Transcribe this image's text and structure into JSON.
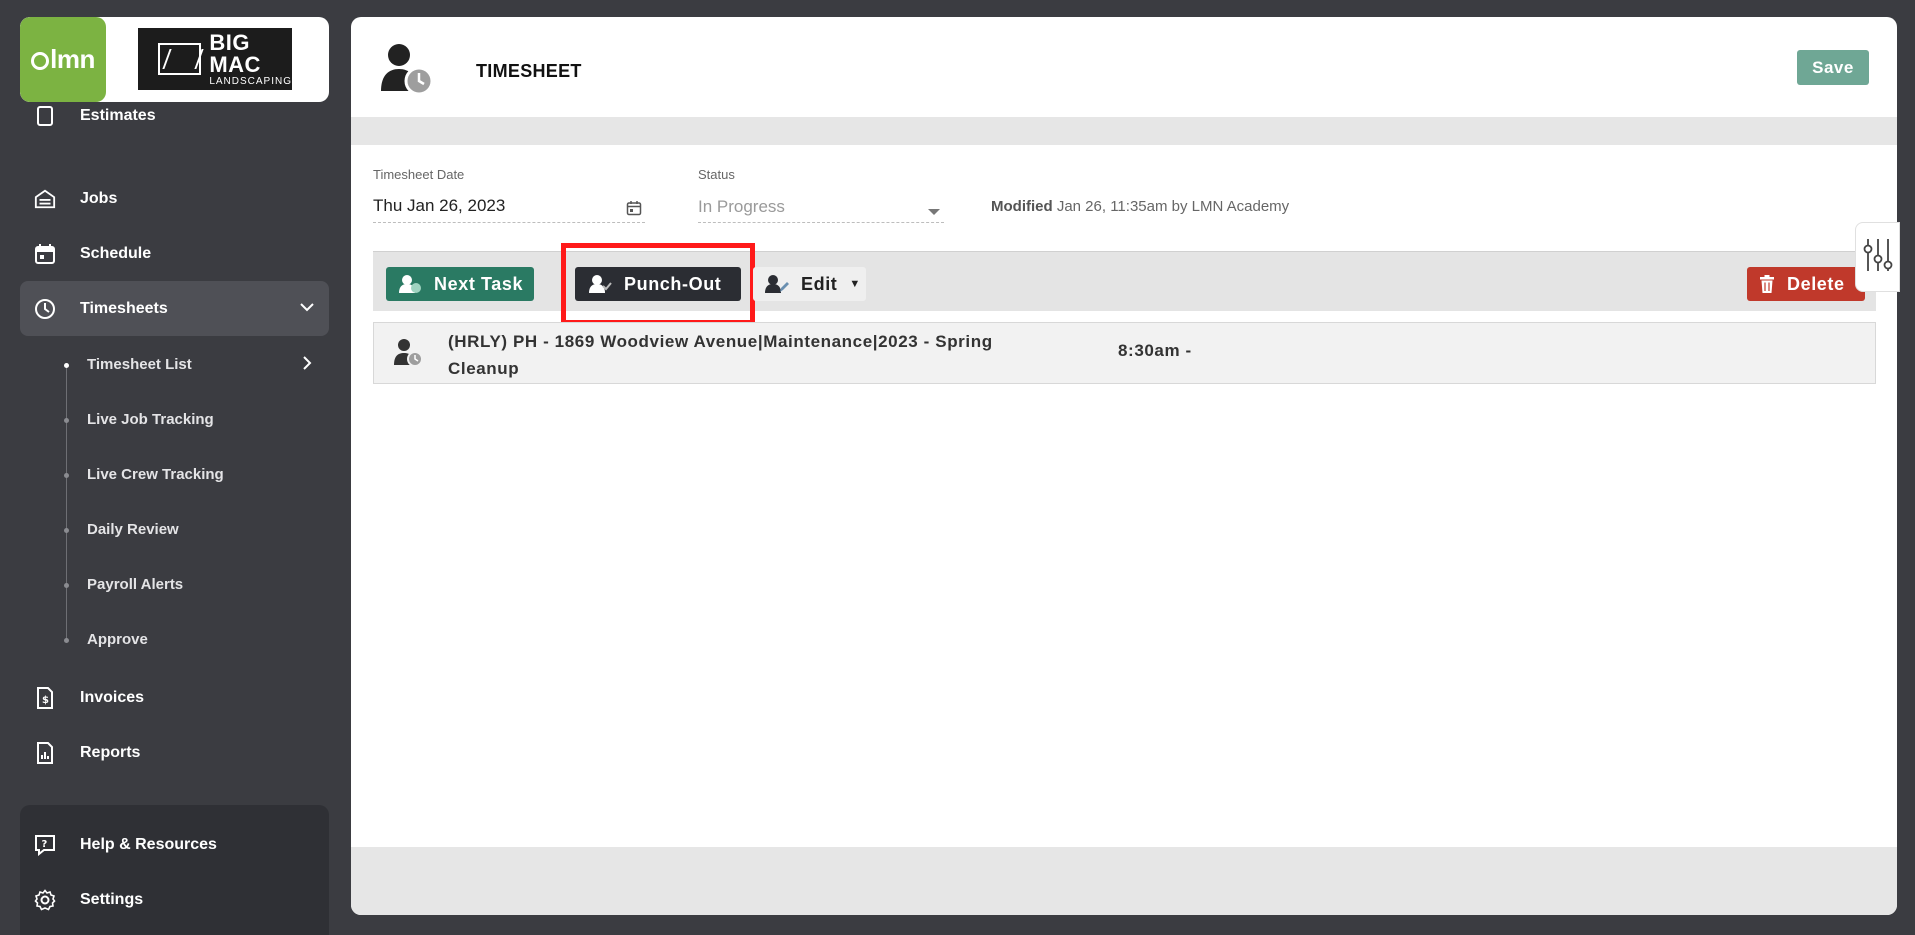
{
  "sidebar": {
    "logo_lmn": "lmn",
    "logo_company_line1": "BIG",
    "logo_company_line2": "MAC",
    "logo_company_line3": "LANDSCAPING",
    "partial_item": "Estimates",
    "items": [
      {
        "label": "Jobs",
        "icon": "jobs-icon"
      },
      {
        "label": "Schedule",
        "icon": "calendar-icon"
      },
      {
        "label": "Timesheets",
        "icon": "clock-icon",
        "active": true
      }
    ],
    "sub_items": [
      {
        "label": "Timesheet List",
        "current": true
      },
      {
        "label": "Live Job Tracking"
      },
      {
        "label": "Live Crew Tracking"
      },
      {
        "label": "Daily Review"
      },
      {
        "label": "Payroll Alerts"
      },
      {
        "label": "Approve"
      }
    ],
    "items_after": [
      {
        "label": "Invoices",
        "icon": "invoice-icon"
      },
      {
        "label": "Reports",
        "icon": "report-icon"
      }
    ],
    "bottom_items": [
      {
        "label": "Help & Resources",
        "icon": "help-icon"
      },
      {
        "label": "Settings",
        "icon": "gear-icon"
      }
    ]
  },
  "header": {
    "title": "TIMESHEET",
    "save_label": "Save"
  },
  "form": {
    "date_label": "Timesheet Date",
    "date_value": "Thu Jan 26, 2023",
    "status_label": "Status",
    "status_value": "In Progress",
    "modified_label": "Modified",
    "modified_value": "Jan 26, 11:35am by LMN Academy"
  },
  "toolbar": {
    "next_task": "Next Task",
    "punch_out": "Punch-Out",
    "edit": "Edit",
    "delete": "Delete"
  },
  "task": {
    "description": "(HRLY) PH - 1869 Woodview Avenue|Maintenance|2023 - Spring Cleanup",
    "time": "8:30am -"
  },
  "colors": {
    "sidebar_bg": "#3b3c41",
    "lmn_green": "#7cb342",
    "save_green": "#6fa795",
    "next_task_green": "#2a7a63",
    "punch_out_dark": "#2b2d33",
    "delete_red": "#c0392b",
    "highlight_red": "#ff1a1a"
  }
}
